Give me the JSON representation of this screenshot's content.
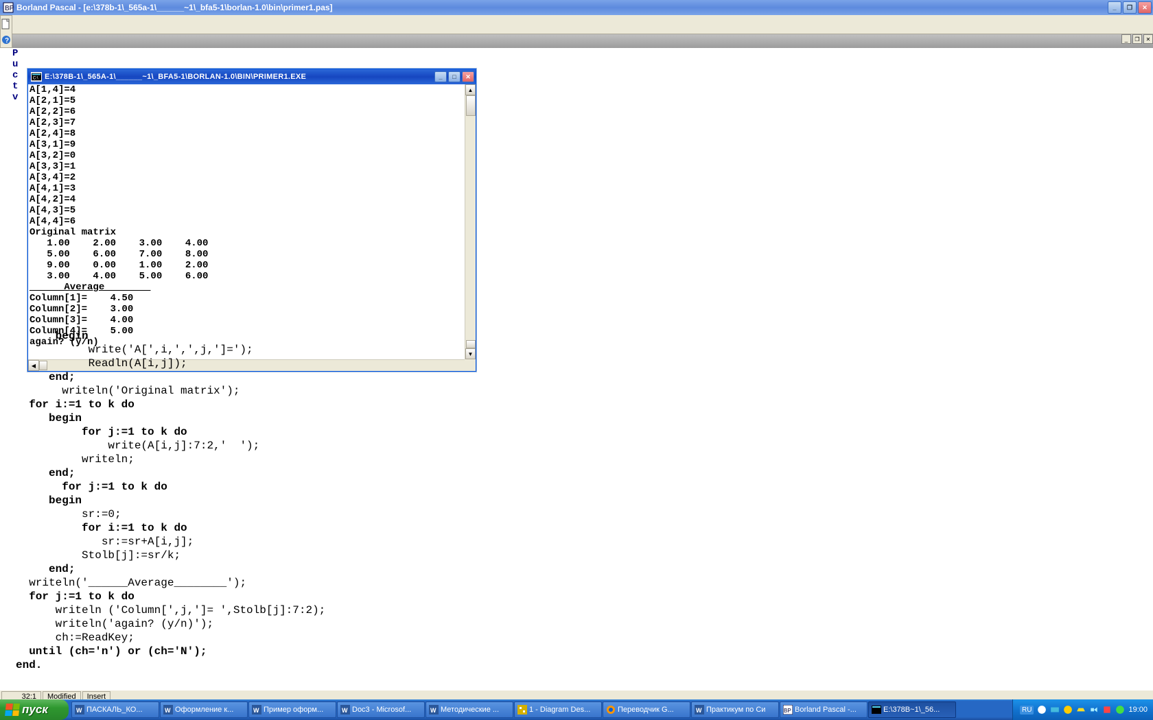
{
  "main_window": {
    "title": "Borland Pascal - [e:\\378b-1\\_565a-1\\______~1\\_bfa5-1\\borlan-1.0\\bin\\primer1.pas]"
  },
  "menu_bg_fragments": [
    "P",
    "u",
    "c",
    "t",
    "v",
    "",
    "",
    "",
    "",
    "",
    "",
    "",
    "B",
    "",
    "",
    "",
    "",
    "w"
  ],
  "exe_window": {
    "title": "E:\\378B-1\\_565A-1\\______~1\\_BFA5-1\\BORLAN-1.0\\BIN\\PRIMER1.EXE",
    "lines": [
      "A[1,4]=4",
      "A[2,1]=5",
      "A[2,2]=6",
      "A[2,3]=7",
      "A[2,4]=8",
      "A[3,1]=9",
      "A[3,2]=0",
      "A[3,3]=1",
      "A[3,4]=2",
      "A[4,1]=3",
      "A[4,2]=4",
      "A[4,3]=5",
      "A[4,4]=6",
      "Original matrix",
      "   1.00    2.00    3.00    4.00",
      "   5.00    6.00    7.00    8.00",
      "   9.00    0.00    1.00    2.00",
      "   3.00    4.00    5.00    6.00",
      "______Average________",
      "Column[1]=    4.50",
      "Column[2]=    3.00",
      "Column[3]=    4.00",
      "Column[4]=    5.00",
      "again? (y/n)"
    ]
  },
  "source": {
    "l1": "      begin",
    "l2": "           write('A[',i,',',j,']=');",
    "l3": "           Readln(A[i,j]);",
    "l4": "     end;",
    "l5": "       writeln('Original matrix');",
    "l6": "  for i:=1 to k do",
    "l7": "     begin",
    "l8": "          for j:=1 to k do",
    "l9": "              write(A[i,j]:7:2,'  ');",
    "l10": "          writeln;",
    "l11": "     end;",
    "l12": "       for j:=1 to k do",
    "l13": "     begin",
    "l14": "          sr:=0;",
    "l15": "          for i:=1 to k do",
    "l16": "             sr:=sr+A[i,j];",
    "l17": "          Stolb[j]:=sr/k;",
    "l18": "     end;",
    "l19": "  writeln('______Average________');",
    "l20": "  for j:=1 to k do",
    "l21": "      writeln ('Column[',j,']= ',Stolb[j]:7:2);",
    "l22": "      writeln('again? (y/n)');",
    "l23": "      ch:=ReadKey;",
    "l24": "  until (ch='n') or (ch='N');",
    "l25": "end."
  },
  "status": {
    "pos": "32:1",
    "mod": "Modified",
    "ins": "Insert"
  },
  "taskbar": {
    "start": "пуск",
    "items": [
      "ПАСКАЛЬ_КО...",
      "Оформление к...",
      "Пример оформ...",
      "Doc3 - Microsof...",
      "Методические ...",
      "1 - Diagram Des...",
      "Переводчик G...",
      "Практикум по Си",
      "Borland Pascal -...",
      "E:\\378B~1\\_56..."
    ],
    "lang": "RU",
    "clock": "19:00"
  }
}
